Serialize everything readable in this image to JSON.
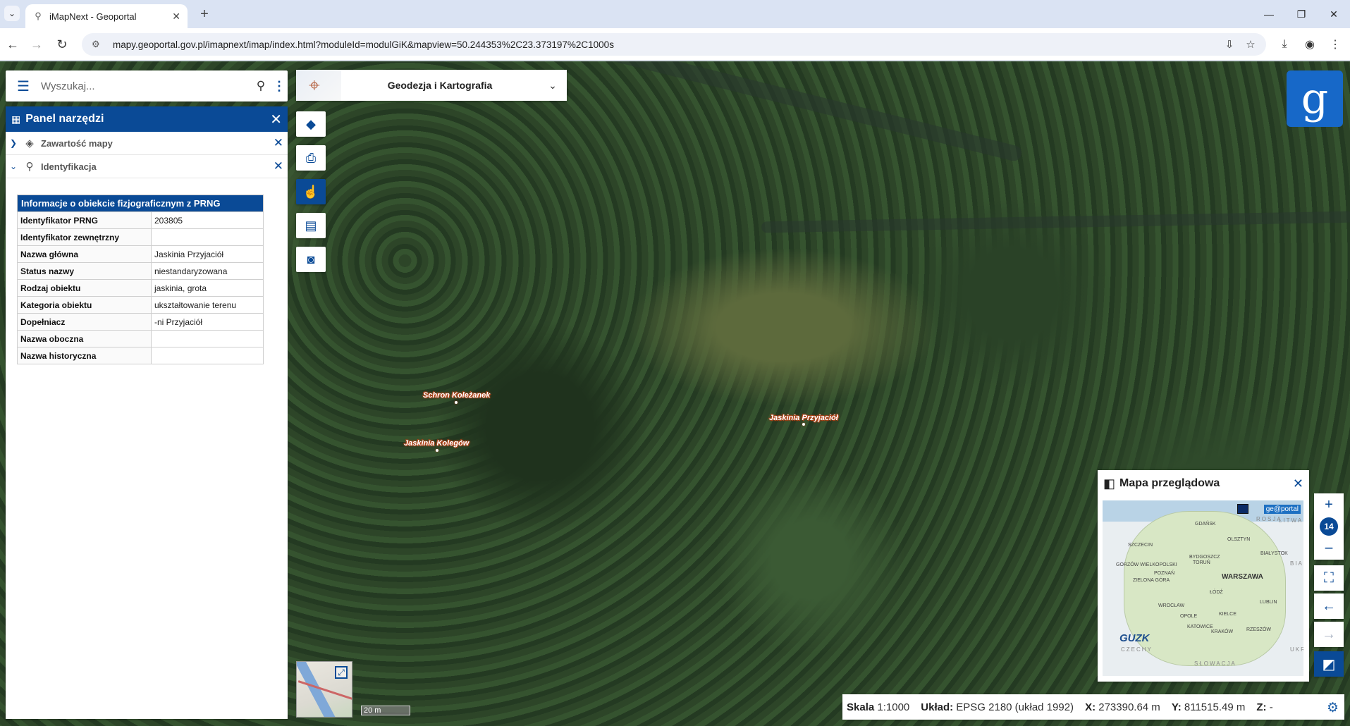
{
  "browser": {
    "tab_title": "iMapNext - Geoportal",
    "url": "mapy.geoportal.gov.pl/imapnext/imap/index.html?moduleId=modulGiK&mapview=50.244353%2C23.373197%2C1000s"
  },
  "search": {
    "placeholder": "Wyszukaj..."
  },
  "tools_panel": {
    "title": "Panel narzędzi",
    "sections": [
      {
        "label": "Zawartość mapy",
        "expanded": false,
        "icon": "layers-icon"
      },
      {
        "label": "Identyfikacja",
        "expanded": true,
        "icon": "search-icon"
      }
    ]
  },
  "info_table": {
    "title": "Informacje o obiekcie fizjograficznym z PRNG",
    "rows": [
      {
        "key": "Identyfikator PRNG",
        "value": "203805"
      },
      {
        "key": "Identyfikator zewnętrzny",
        "value": ""
      },
      {
        "key": "Nazwa główna",
        "value": "Jaskinia Przyjaciół"
      },
      {
        "key": "Status nazwy",
        "value": "niestandaryzowana"
      },
      {
        "key": "Rodzaj obiektu",
        "value": "jaskinia, grota"
      },
      {
        "key": "Kategoria obiektu",
        "value": "ukształtowanie terenu"
      },
      {
        "key": "Dopełniacz",
        "value": "-ni Przyjaciół"
      },
      {
        "key": "Nazwa oboczna",
        "value": ""
      },
      {
        "key": "Nazwa historyczna",
        "value": ""
      }
    ]
  },
  "module": {
    "name": "Geodezja i Kartografia"
  },
  "map_labels": {
    "schron": "Schron Koleżanek",
    "kolegow": "Jaskinia Kolegów",
    "przyjaciol": "Jaskinia Przyjaciół"
  },
  "overview_map": {
    "title": "Mapa przeglądowa",
    "brand": "ge@portal",
    "guzk": "GUZK",
    "cities": {
      "gdansk": "GDAŃSK",
      "olsztyn": "OLSZTYN",
      "szczecin": "SZCZECIN",
      "bydgoszcz": "BYDGOSZCZ",
      "torun": "TORUŃ",
      "bialystok": "BIAŁYSTOK",
      "gorzow": "GORZÓW WIELKOPOLSKI",
      "poznan": "POZNAŃ",
      "warszawa": "WARSZAWA",
      "zielona": "ZIELONA GÓRA",
      "lodz": "ŁÓDŹ",
      "lublin": "LUBLIN",
      "wroclaw": "WROCŁAW",
      "opole": "OPOLE",
      "kielce": "KIELCE",
      "katowice": "KATOWICE",
      "krakow": "KRAKÓW",
      "rzeszow": "RZESZÓW"
    },
    "countries": {
      "rosja": "ROSJA",
      "litwa": "LITWA",
      "czechy": "CZECHY",
      "slowacja": "SŁOWACJA",
      "bia": "BIA",
      "ukr": "UKR"
    }
  },
  "zoom": {
    "level": "14"
  },
  "scale_bar": {
    "label": "20 m"
  },
  "status": {
    "scale_label": "Skala",
    "scale_value": "1:1000",
    "crs_label": "Układ:",
    "crs_value": "EPSG 2180 (układ 1992)",
    "x_label": "X:",
    "x_value": "273390.64 m",
    "y_label": "Y:",
    "y_value": "811515.49 m",
    "z_label": "Z:",
    "z_value": "-"
  },
  "colors": {
    "primary": "#0a4a96",
    "logo": "#1768c8",
    "label_halo": "#b2451b"
  }
}
